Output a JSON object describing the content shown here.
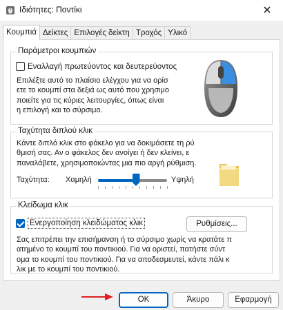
{
  "window": {
    "title": "Ιδιότητες: Ποντίκι",
    "close_glyph": "✕"
  },
  "tabs": [
    {
      "label": "Κουμπιά",
      "active": true
    },
    {
      "label": "Δείκτες",
      "active": false
    },
    {
      "label": "Επιλογές δείκτη",
      "active": false
    },
    {
      "label": "Τροχός",
      "active": false
    },
    {
      "label": "Υλικό",
      "active": false
    }
  ],
  "button_config": {
    "legend": "Παράμετροι κουμπιών",
    "checkbox_label": "Εναλλαγή πρωτεύοντος και δευτερεύοντος",
    "checked": false,
    "description_lines": [
      "Επιλέξτε αυτό το πλαίσιο ελέγχου για να ορίσ",
      "ετε το κουμπί στα δεξιά ως αυτό που χρησιμο",
      "ποιείτε για τις κύριες λειτουργίες, όπως είναι",
      "η επιλογή και το σύρσιμο."
    ],
    "illustration_icon": "mouse-icon"
  },
  "double_click": {
    "legend": "Ταχύτητα διπλού κλικ",
    "description_lines": [
      "Κάντε διπλό κλικ στο φάκελο για να δοκιμάσετε τη ρύ",
      "θμισή σας.  Αν ο φάκελος δεν ανοίγει ή δεν κλείνει, ε",
      "παναλάβετε, χρησιμοποιώντας μια πιο αργή ρύθμιση."
    ],
    "speed_label": "Ταχύτητα:",
    "slow_label": "Χαμηλή",
    "fast_label": "Υψηλή",
    "slider_level": 0.55,
    "test_icon": "folder-icon"
  },
  "click_lock": {
    "legend": "Κλείδωμα κλικ",
    "checkbox_label": "Ενεργοποίηση κλειδώματος κλικ",
    "checked": true,
    "settings_button": "Ρυθμίσεις...",
    "description_lines": [
      "Σας επιτρέπει την επισήμανση ή το σύρσιμο χωρίς να κρατάτε π",
      "ατημένο το κουμπί του ποντικιού.  Για να οριστεί, πατήστε σύντ",
      "ομα το κουμπί του ποντικιού.  Για να αποδεσμευτεί, κάντε πάλι κ",
      "λικ με το κουμπί του ποντικιού."
    ]
  },
  "footer": {
    "ok": "OK",
    "cancel": "Άκυρο",
    "apply": "Εφαρμογή"
  },
  "annotation": {
    "arrow_color": "#e02020"
  },
  "colors": {
    "accent": "#0067c0"
  }
}
